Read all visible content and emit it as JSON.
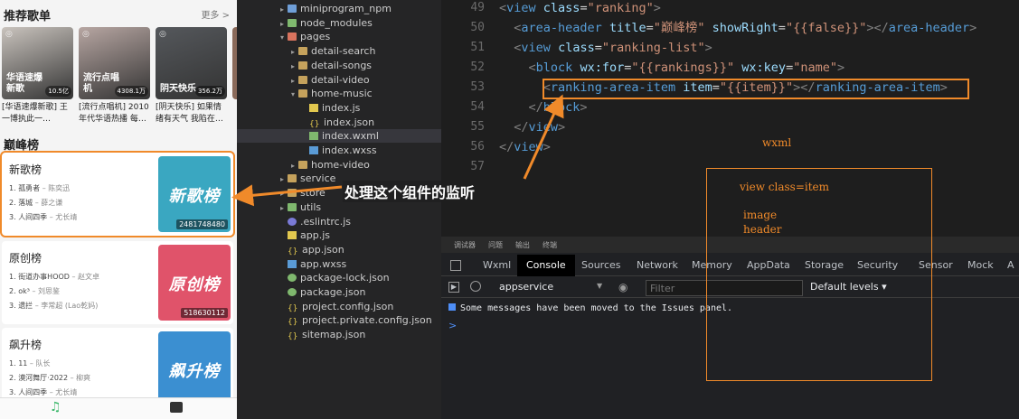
{
  "phone": {
    "recommend_title": "推荐歌单",
    "more_label": "更多 >",
    "playlists": [
      {
        "cover_text": "华语速爆新歌",
        "count": "10.5亿",
        "desc": "[华语速爆新歌] 王一博执此一…",
        "color": "#c9c3bd"
      },
      {
        "cover_text": "流行点唱机",
        "count": "4308.1万",
        "desc": "[流行点唱机] 2010年代华语热播 每…",
        "color": "#b7a6a2"
      },
      {
        "cover_text": "阴天快乐",
        "count": "356.2万",
        "desc": "[阴天快乐] 如果情绪有天气 我陷在…",
        "color": "#55585c"
      }
    ],
    "ranking_title": "巅峰榜",
    "rankings": [
      {
        "name": "新歌榜",
        "cover_text": "新歌榜",
        "play_count": "2481748480",
        "color": "#3aa7c1",
        "songs": [
          {
            "idx": "1.",
            "title": "孤勇者",
            "singer": "– 陈奕迅"
          },
          {
            "idx": "2.",
            "title": "落城",
            "singer": "– 薛之谦"
          },
          {
            "idx": "3.",
            "title": "人间四季",
            "singer": "– 尤长靖"
          }
        ]
      },
      {
        "name": "原创榜",
        "cover_text": "原创榜",
        "play_count": "518630112",
        "color": "#e0536a",
        "songs": [
          {
            "idx": "1.",
            "title": "街道办事HOOD",
            "singer": "– 赵文卓"
          },
          {
            "idx": "2.",
            "title": "ok³",
            "singer": "– 刘思鉴"
          },
          {
            "idx": "3.",
            "title": "遗拦",
            "singer": "– 李常超 (Lao乾妈)"
          }
        ]
      },
      {
        "name": "飙升榜",
        "cover_text": "飙升榜",
        "play_count": "",
        "color": "#3b8fd1",
        "songs": [
          {
            "idx": "1.",
            "title": "11",
            "singer": "– 队长"
          },
          {
            "idx": "2.",
            "title": "漠河舞厅·2022",
            "singer": "– 柳爽"
          },
          {
            "idx": "3.",
            "title": "人间四季",
            "singer": "– 尤长靖"
          }
        ]
      }
    ],
    "tab_icons": [
      "music-note-icon",
      "video-icon"
    ]
  },
  "explorer": {
    "items": [
      {
        "label": "miniprogram_npm",
        "depth": 1,
        "type": "folder",
        "color": "blue",
        "open": false
      },
      {
        "label": "node_modules",
        "depth": 1,
        "type": "folder",
        "color": "green",
        "open": false
      },
      {
        "label": "pages",
        "depth": 1,
        "type": "folder",
        "color": "red",
        "open": true
      },
      {
        "label": "detail-search",
        "depth": 2,
        "type": "folder",
        "color": "",
        "open": false
      },
      {
        "label": "detail-songs",
        "depth": 2,
        "type": "folder",
        "color": "",
        "open": false
      },
      {
        "label": "detail-video",
        "depth": 2,
        "type": "folder",
        "color": "",
        "open": false
      },
      {
        "label": "home-music",
        "depth": 2,
        "type": "folder",
        "color": "",
        "open": true
      },
      {
        "label": "index.js",
        "depth": 3,
        "type": "js"
      },
      {
        "label": "index.json",
        "depth": 3,
        "type": "json"
      },
      {
        "label": "index.wxml",
        "depth": 3,
        "type": "wxml",
        "active": true
      },
      {
        "label": "index.wxss",
        "depth": 3,
        "type": "wxss"
      },
      {
        "label": "home-video",
        "depth": 2,
        "type": "folder",
        "color": "",
        "open": false
      },
      {
        "label": "service",
        "depth": 1,
        "type": "folder",
        "color": "",
        "open": false
      },
      {
        "label": "store",
        "depth": 1,
        "type": "folder",
        "color": "",
        "open": false
      },
      {
        "label": "utils",
        "depth": 1,
        "type": "folder",
        "color": "green",
        "open": false
      },
      {
        "label": ".eslintrc.js",
        "depth": 1,
        "type": "rc"
      },
      {
        "label": "app.js",
        "depth": 1,
        "type": "js"
      },
      {
        "label": "app.json",
        "depth": 1,
        "type": "json"
      },
      {
        "label": "app.wxss",
        "depth": 1,
        "type": "wxss"
      },
      {
        "label": "package-lock.json",
        "depth": 1,
        "type": "pkg"
      },
      {
        "label": "package.json",
        "depth": 1,
        "type": "pkg"
      },
      {
        "label": "project.config.json",
        "depth": 1,
        "type": "json"
      },
      {
        "label": "project.private.config.json",
        "depth": 1,
        "type": "json"
      },
      {
        "label": "sitemap.json",
        "depth": 1,
        "type": "json"
      }
    ]
  },
  "editor": {
    "lines": [
      {
        "num": "49",
        "indent": "",
        "tokens": [
          [
            "pu",
            "<"
          ],
          [
            "tg",
            "view"
          ],
          [
            "mu",
            " "
          ],
          [
            "at",
            "class"
          ],
          [
            "mu",
            "="
          ],
          [
            "st",
            "\"ranking\""
          ],
          [
            "pu",
            ">"
          ]
        ]
      },
      {
        "num": "50",
        "indent": "  ",
        "tokens": [
          [
            "pu",
            "<"
          ],
          [
            "tg",
            "area-header"
          ],
          [
            "mu",
            " "
          ],
          [
            "at",
            "title"
          ],
          [
            "mu",
            "="
          ],
          [
            "st",
            "\"巅峰榜\""
          ],
          [
            "mu",
            " "
          ],
          [
            "at",
            "showRight"
          ],
          [
            "mu",
            "="
          ],
          [
            "st",
            "\"{{false}}\""
          ],
          [
            "pu",
            "></"
          ],
          [
            "tg",
            "area-header"
          ],
          [
            "pu",
            ">"
          ]
        ]
      },
      {
        "num": "51",
        "indent": "  ",
        "tokens": [
          [
            "pu",
            "<"
          ],
          [
            "tg",
            "view"
          ],
          [
            "mu",
            " "
          ],
          [
            "at",
            "class"
          ],
          [
            "mu",
            "="
          ],
          [
            "st",
            "\"ranking-list\""
          ],
          [
            "pu",
            ">"
          ]
        ]
      },
      {
        "num": "52",
        "indent": "    ",
        "tokens": [
          [
            "pu",
            "<"
          ],
          [
            "tg",
            "block"
          ],
          [
            "mu",
            " "
          ],
          [
            "at",
            "wx:for"
          ],
          [
            "mu",
            "="
          ],
          [
            "st",
            "\"{{rankings}}\""
          ],
          [
            "mu",
            " "
          ],
          [
            "at",
            "wx:key"
          ],
          [
            "mu",
            "="
          ],
          [
            "st",
            "\"name\""
          ],
          [
            "pu",
            ">"
          ]
        ]
      },
      {
        "num": "53",
        "indent": "      ",
        "tokens": [
          [
            "pu",
            "<"
          ],
          [
            "tg",
            "ranking-area-item"
          ],
          [
            "mu",
            " "
          ],
          [
            "at",
            "item"
          ],
          [
            "mu",
            "="
          ],
          [
            "st",
            "\"{{item}}\""
          ],
          [
            "pu",
            "></"
          ],
          [
            "tg",
            "ranking-area-item"
          ],
          [
            "pu",
            ">"
          ]
        ]
      },
      {
        "num": "54",
        "indent": "    ",
        "tokens": [
          [
            "pu",
            "</"
          ],
          [
            "tg",
            "block"
          ],
          [
            "pu",
            ">"
          ]
        ]
      },
      {
        "num": "55",
        "indent": "  ",
        "tokens": [
          [
            "pu",
            "</"
          ],
          [
            "tg",
            "view"
          ],
          [
            "pu",
            ">"
          ]
        ]
      },
      {
        "num": "56",
        "indent": "",
        "tokens": [
          [
            "pu",
            "</"
          ],
          [
            "tg",
            "view"
          ],
          [
            "pu",
            ">"
          ]
        ]
      },
      {
        "num": "57",
        "indent": "",
        "tokens": []
      }
    ]
  },
  "devtools": {
    "top_labels": [
      "调试器",
      "问题",
      "输出",
      "终端"
    ],
    "tabs": [
      "Wxml",
      "Console",
      "Sources",
      "Network",
      "Memory",
      "AppData",
      "Storage",
      "Security",
      "Sensor",
      "Mock",
      "A"
    ],
    "active_tab": "Console",
    "context": "appservice",
    "filter_placeholder": "Filter",
    "levels": "Default levels ▾",
    "message": "Some messages have been moved to the Issues panel.",
    "prompt": ">"
  },
  "annotations": {
    "callout": "处理这个组件的监听",
    "wxml": "wxml",
    "view_item": "view class=item",
    "image": "image",
    "header": "header",
    "color": "#f08a2a"
  }
}
